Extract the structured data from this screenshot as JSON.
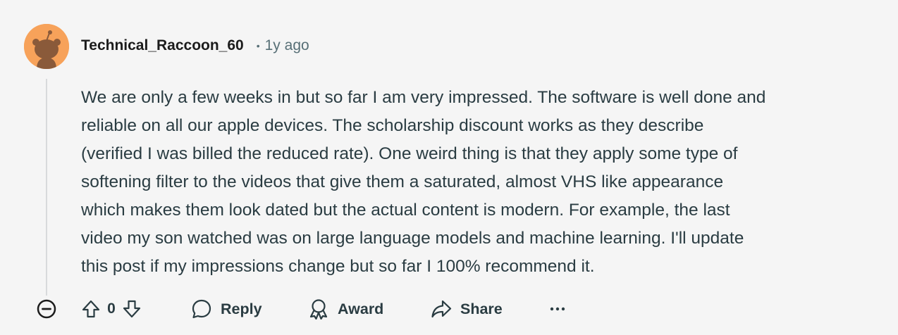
{
  "comment": {
    "author": "Technical_Raccoon_60",
    "separator": "•",
    "timestamp": "1y ago",
    "avatar_color": "#f7a25a",
    "lines": [
      "We are only a few weeks in but so far I am very impressed. The software is well done and",
      "reliable on all our apple devices. The scholarship discount works as they describe",
      "(verified I was billed the reduced rate). One weird thing is that they apply some type of",
      "softening filter to the videos that give them a saturated, almost VHS like appearance",
      "which makes them look dated but the actual content is modern. For example, the last",
      "video my son watched was on large language models and machine learning. I'll update",
      "this post if my impressions change but so far I 100% recommend it."
    ]
  },
  "actions": {
    "vote_count": "0",
    "reply_label": "Reply",
    "award_label": "Award",
    "share_label": "Share",
    "more_label": "···"
  },
  "icons": {
    "collapse": "minus-circle-icon",
    "upvote": "arrow-up-icon",
    "downvote": "arrow-down-icon",
    "reply": "speech-bubble-icon",
    "award": "award-ribbon-icon",
    "share": "share-arrow-icon"
  }
}
